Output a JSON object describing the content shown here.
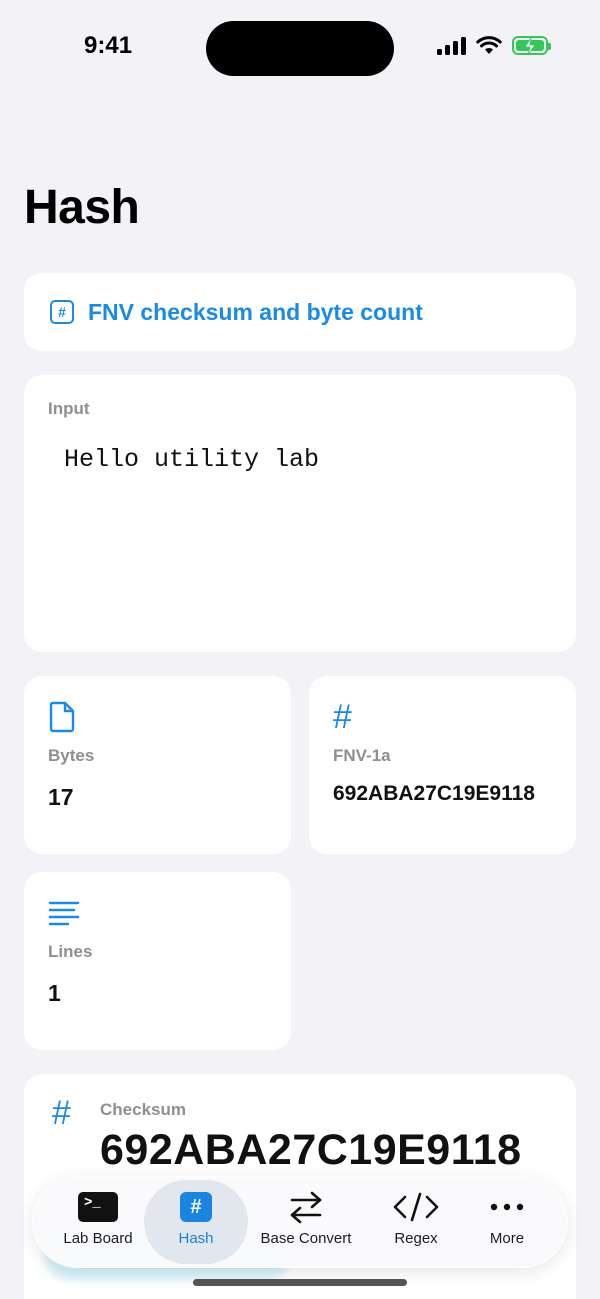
{
  "status_bar": {
    "time": "9:41"
  },
  "page": {
    "title": "Hash"
  },
  "mode": {
    "label": "FNV checksum and byte count",
    "icon": "hash-square-icon"
  },
  "input": {
    "label": "Input",
    "value": "Hello utility lab"
  },
  "stats": {
    "bytes": {
      "label": "Bytes",
      "value": "17",
      "icon": "document-icon"
    },
    "fnv": {
      "label": "FNV-1a",
      "value": "692ABA27C19E9118",
      "icon": "hash-icon"
    },
    "lines": {
      "label": "Lines",
      "value": "1",
      "icon": "text-lines-icon"
    }
  },
  "checksum": {
    "label": "Checksum",
    "value": "692ABA27C19E9118",
    "icon": "hash-icon"
  },
  "tabs": [
    {
      "label": "Lab Board",
      "icon": "terminal-icon",
      "active": false
    },
    {
      "label": "Hash",
      "icon": "hash-square-icon",
      "active": true
    },
    {
      "label": "Base Convert",
      "icon": "arrows-swap-icon",
      "active": false
    },
    {
      "label": "Regex",
      "icon": "code-brackets-icon",
      "active": false
    },
    {
      "label": "More",
      "icon": "ellipsis-icon",
      "active": false
    }
  ],
  "colors": {
    "accent": "#1a8ae5",
    "background": "#f2f2f7",
    "card": "#ffffff",
    "battery": "#34c759"
  }
}
